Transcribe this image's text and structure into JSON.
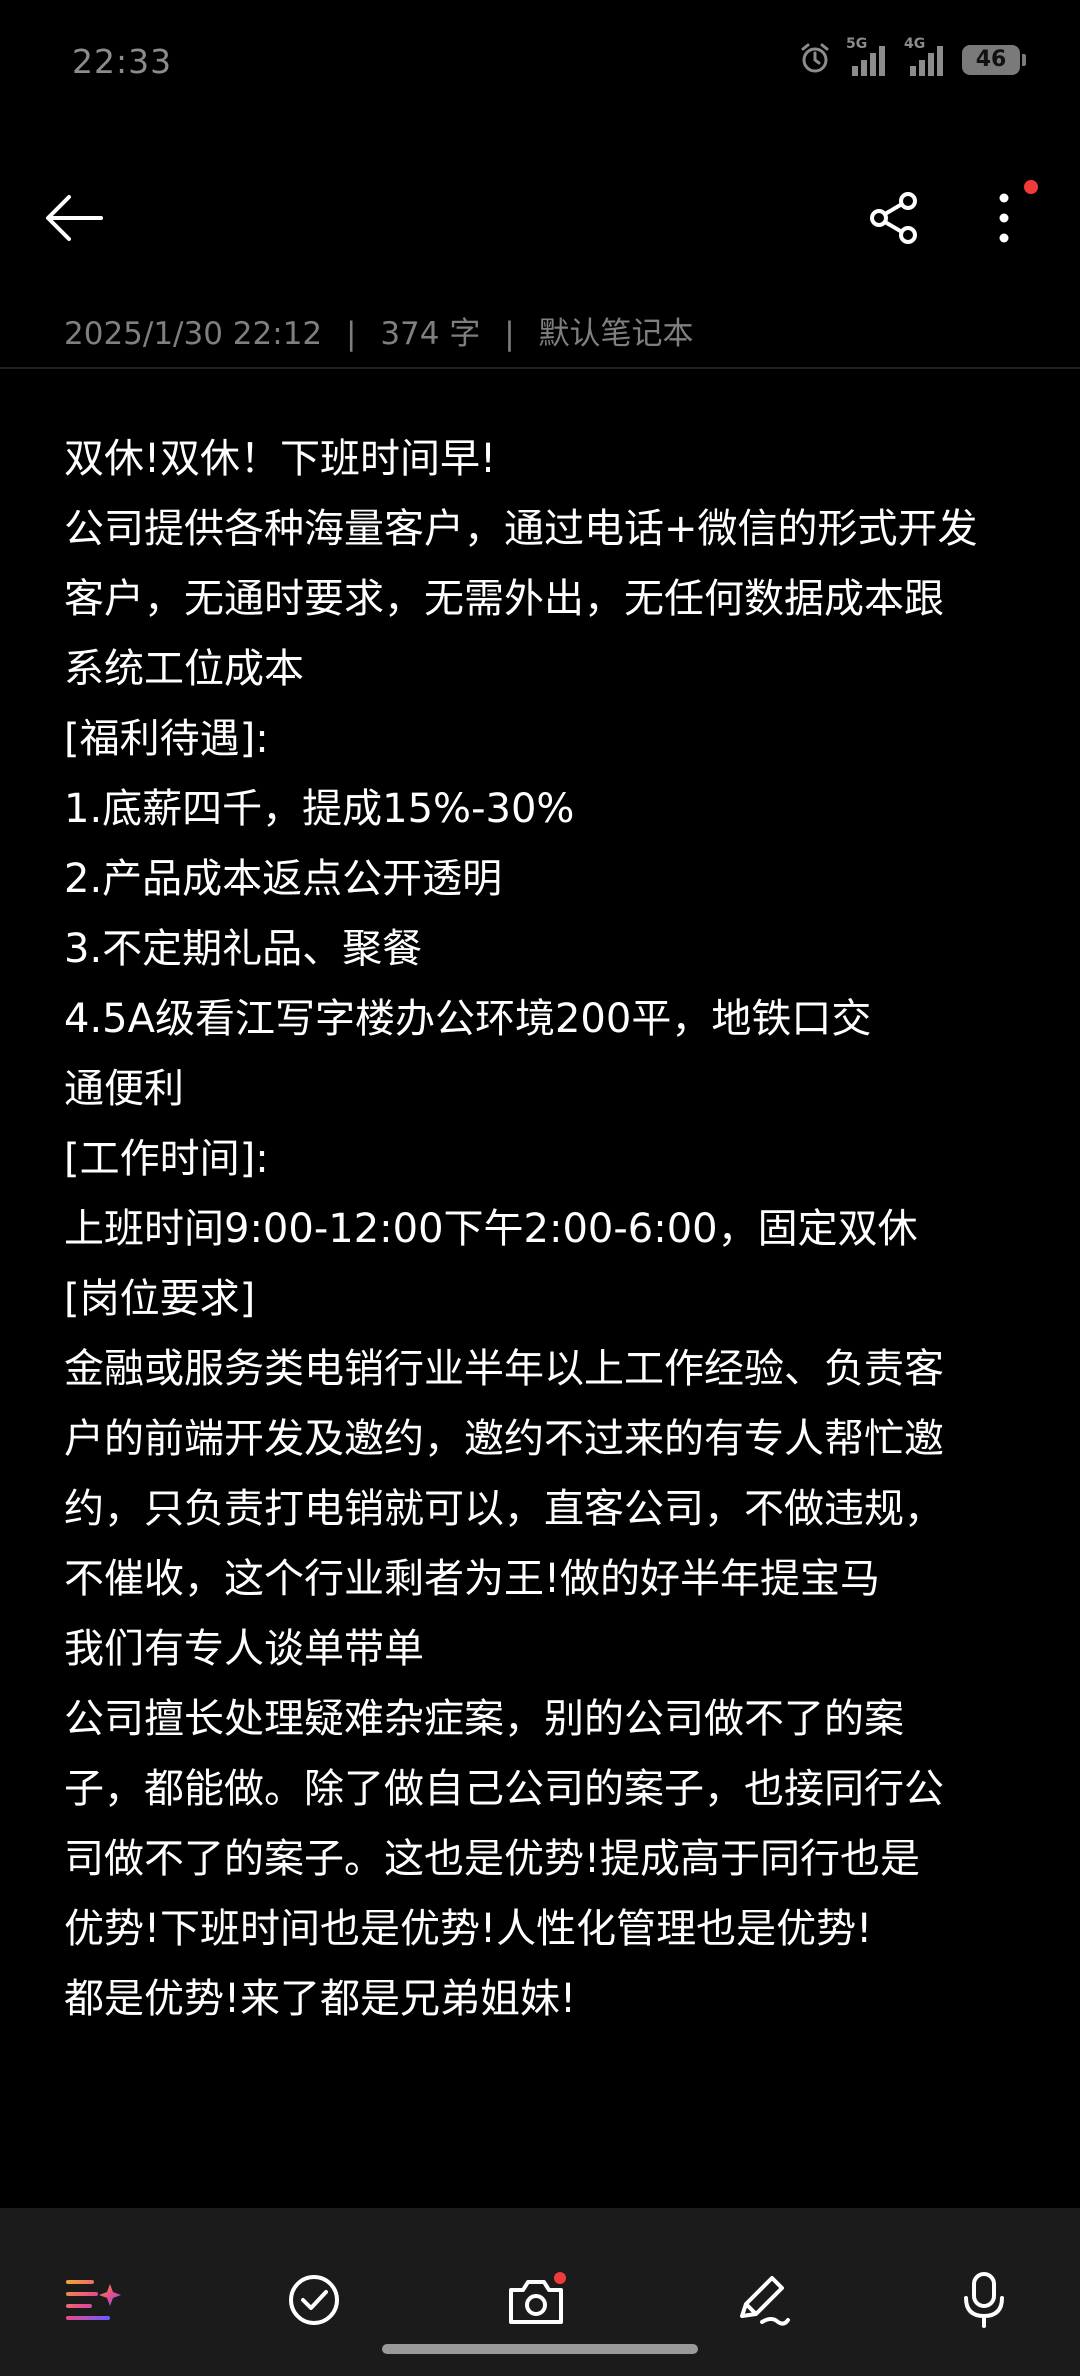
{
  "status_bar": {
    "time": "22:33",
    "signal_1_label": "5G",
    "signal_2_label": "4G",
    "battery": "46",
    "icons": [
      "alarm-icon",
      "signal-5g-icon",
      "signal-4g-icon",
      "battery-icon"
    ]
  },
  "toolbar": {
    "back_icon": "back-arrow-icon",
    "share_icon": "share-icon",
    "more_icon": "more-vertical-icon",
    "notification_dot_color": "#f03b3b"
  },
  "meta": {
    "date": "2025/1/30 22:12",
    "separator": "|",
    "word_count": "374 字",
    "notebook": "默认笔记本"
  },
  "note": {
    "lines": [
      "双休!双休！下班时间早!",
      "公司提供各种海量客户，通过电话+微信的形式开发",
      "客户，无通时要求，无需外出，无任何数据成本跟",
      "系统工位成本",
      "[福利待遇]:",
      "1.底薪四千，提成15%-30%",
      "2.产品成本返点公开透明",
      "3.不定期礼品、聚餐",
      "4.5A级看江写字楼办公环境200平，地铁口交",
      "通便利",
      "[工作时间]:",
      "上班时间9:00-12:00下午2:00-6:00，固定双休",
      "[岗位要求]",
      "金融或服务类电销行业半年以上工作经验、负责客",
      "户的前端开发及邀约，邀约不过来的有专人帮忙邀",
      "约，只负责打电销就可以，直客公司，不做违规，",
      "不催收，这个行业剩者为王!做的好半年提宝马",
      "我们有专人谈单带单",
      "公司擅长处理疑难杂症案，别的公司做不了的案",
      "子，都能做。除了做自己公司的案子，也接同行公",
      "司做不了的案子。这也是优势!提成高于同行也是",
      "优势!下班时间也是优势!人性化管理也是优势!",
      "都是优势!来了都是兄弟姐妹!"
    ]
  },
  "bottom_bar": {
    "icons": [
      "ai-format-icon",
      "checklist-icon",
      "camera-icon",
      "pen-icon",
      "microphone-icon"
    ]
  },
  "colors": {
    "background": "#000000",
    "text": "#ffffff",
    "meta_text": "#7f7f7f",
    "bottom_bar": "#1b1b1b",
    "accent_red": "#f03b3b"
  }
}
